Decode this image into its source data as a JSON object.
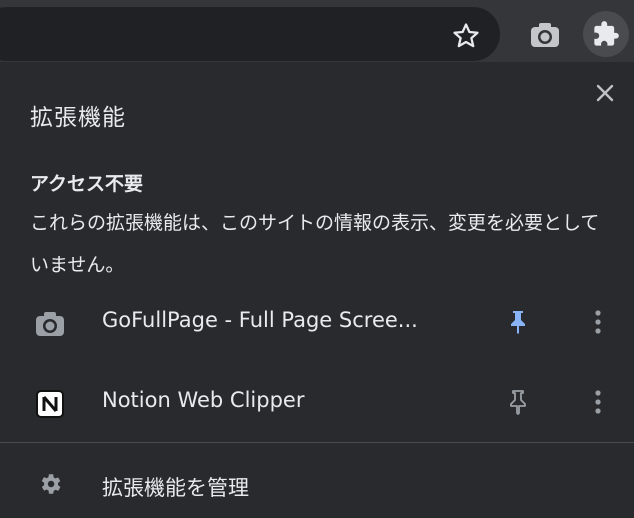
{
  "toolbar": {
    "star_icon": "star-outline-icon",
    "camera_icon": "camera-icon",
    "extensions_icon": "puzzle-icon"
  },
  "panel": {
    "title": "拡張機能",
    "close_icon": "close-icon",
    "section_title": "アクセス不要",
    "section_desc": "これらの拡張機能は、このサイトの情報の表示、変更を必要としていません。",
    "extensions": [
      {
        "name": "GoFullPage - Full Page Scree...",
        "icon": "camera-icon",
        "pinned": true
      },
      {
        "name": "Notion Web Clipper",
        "icon": "notion-icon",
        "pinned": false
      }
    ],
    "manage_label": "拡張機能を管理",
    "manage_icon": "gear-icon"
  },
  "colors": {
    "background": "#292a2d",
    "toolbar": "#35363a",
    "omnibox": "#202124",
    "text": "#e8eaed",
    "pinned_accent": "#8ab4f8",
    "icon_gray": "#9aa0a6"
  }
}
